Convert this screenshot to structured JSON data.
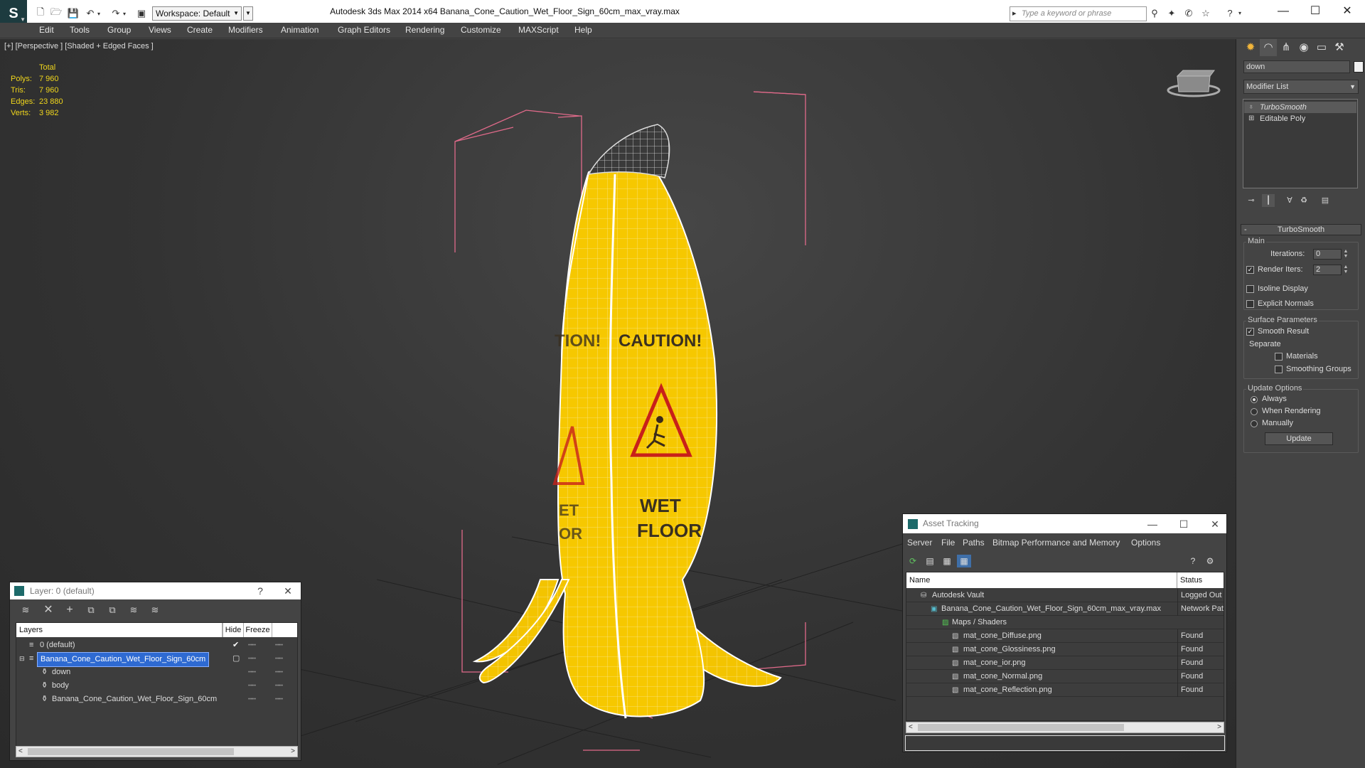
{
  "titlebar": {
    "workspace": "Workspace: Default",
    "title": "Autodesk 3ds Max  2014 x64      Banana_Cone_Caution_Wet_Floor_Sign_60cm_max_vray.max",
    "search_placeholder": "Type a keyword or phrase"
  },
  "menu": [
    "Edit",
    "Tools",
    "Group",
    "Views",
    "Create",
    "Modifiers",
    "Animation",
    "Graph Editors",
    "Rendering",
    "Customize",
    "MAXScript",
    "Help"
  ],
  "viewport": {
    "label": "[+] [Perspective ] [Shaded + Edged Faces ]",
    "stats": {
      "header": "Total",
      "rows": [
        {
          "label": "Polys:",
          "value": "7 960"
        },
        {
          "label": "Tris:",
          "value": "7 960"
        },
        {
          "label": "Edges:",
          "value": "23 880"
        },
        {
          "label": "Verts:",
          "value": "3 982"
        }
      ]
    },
    "sign_text": {
      "caution": "CAUTION!",
      "wet": "WET",
      "floor": "FLOOR"
    }
  },
  "command_panel": {
    "object_name": "down",
    "modifier_list": "Modifier List",
    "stack": [
      "TurboSmooth",
      "Editable Poly"
    ],
    "rollout_title": "TurboSmooth",
    "main_label": "Main",
    "iterations_label": "Iterations:",
    "iterations_value": "0",
    "render_iters_label": "Render Iters:",
    "render_iters_value": "2",
    "isoline": "Isoline Display",
    "explicit": "Explicit Normals",
    "surface_label": "Surface Parameters",
    "smooth_result": "Smooth Result",
    "separate": "Separate",
    "materials": "Materials",
    "smoothing_groups": "Smoothing Groups",
    "update_options": "Update Options",
    "always": "Always",
    "when_rendering": "When Rendering",
    "manually": "Manually",
    "update_button": "Update"
  },
  "layer_window": {
    "title": "Layer: 0 (default)",
    "help": "?",
    "columns": [
      "Layers",
      "Hide",
      "Freeze"
    ],
    "rows": [
      "0 (default)",
      "Banana_Cone_Caution_Wet_Floor_Sign_60cm",
      "down",
      "body",
      "Banana_Cone_Caution_Wet_Floor_Sign_60cm"
    ]
  },
  "asset_window": {
    "title": "Asset Tracking",
    "menu": [
      "Server",
      "File",
      "Paths",
      "Bitmap Performance and Memory",
      "Options"
    ],
    "columns": [
      "Name",
      "Status"
    ],
    "rows": [
      {
        "name": "Autodesk Vault",
        "status": "Logged Out"
      },
      {
        "name": "Banana_Cone_Caution_Wet_Floor_Sign_60cm_max_vray.max",
        "status": "Network Pat"
      },
      {
        "name": "Maps / Shaders",
        "status": ""
      },
      {
        "name": "mat_cone_Diffuse.png",
        "status": "Found"
      },
      {
        "name": "mat_cone_Glossiness.png",
        "status": "Found"
      },
      {
        "name": "mat_cone_ior.png",
        "status": "Found"
      },
      {
        "name": "mat_cone_Normal.png",
        "status": "Found"
      },
      {
        "name": "mat_cone_Reflection.png",
        "status": "Found"
      }
    ]
  }
}
